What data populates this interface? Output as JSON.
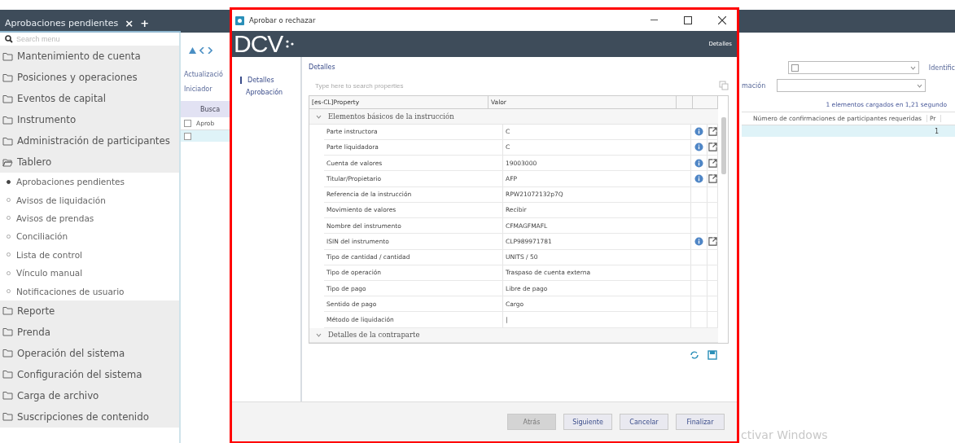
{
  "app": {
    "tab": {
      "label": "Aprobaciones pendientes",
      "close": "×",
      "add": "+"
    },
    "search_placeholder": "Search menu",
    "menu": [
      {
        "label": "Mantenimiento de cuenta",
        "expanded": false
      },
      {
        "label": "Posiciones y operaciones",
        "expanded": false
      },
      {
        "label": "Eventos de capital",
        "expanded": false
      },
      {
        "label": "Instrumento",
        "expanded": false
      },
      {
        "label": "Administración de participantes",
        "expanded": false
      },
      {
        "label": "Tablero",
        "expanded": true,
        "children": [
          {
            "label": "Aprobaciones pendientes",
            "selected": true
          },
          {
            "label": "Avisos de liquidación",
            "selected": false
          },
          {
            "label": "Avisos de prendas",
            "selected": false
          },
          {
            "label": "Conciliación",
            "selected": false
          },
          {
            "label": "Lista de control",
            "selected": false
          },
          {
            "label": "Vínculo manual",
            "selected": false
          },
          {
            "label": "Notificaciones de usuario",
            "selected": false
          }
        ]
      },
      {
        "label": "Reporte",
        "expanded": false
      },
      {
        "label": "Prenda",
        "expanded": false
      },
      {
        "label": "Operación del sistema",
        "expanded": false
      },
      {
        "label": "Configuración del sistema",
        "expanded": false
      },
      {
        "label": "Carga de archivo",
        "expanded": false
      },
      {
        "label": "Suscripciones de contenido",
        "expanded": false
      }
    ]
  },
  "background": {
    "left": {
      "labels": [
        "Actualizació",
        "Iniciador"
      ],
      "search_button": "Busca",
      "column": "Aprob",
      "select_all": {
        "checked": false
      }
    },
    "right": {
      "label_1": "Identific",
      "label_2": "mación",
      "status": "1 elementos cargados en 1,21 segundo",
      "column": "Número de confirmaciones de participantes requeridas",
      "column_2": "Pr",
      "rows": [
        {
          "value": "1",
          "selected": true,
          "checked": false
        }
      ]
    }
  },
  "dialog": {
    "title": "Aprobar o rechazar",
    "logo": "DCV",
    "header_link": "Detalles",
    "nav": [
      {
        "label": "Detalles",
        "selected": true
      },
      {
        "label": "Aprobación",
        "selected": false
      }
    ],
    "group_label": "Detalles",
    "search_placeholder": "Type here to search properties",
    "columns": [
      "[es-CL]Property",
      "Valor"
    ],
    "groups": [
      {
        "label": "Elementos básicos de la instrucción",
        "expanded": true,
        "rows": [
          {
            "property": "Parte instructora",
            "value": "C",
            "has_actions": true
          },
          {
            "property": "Parte liquidadora",
            "value": "C",
            "has_actions": true
          },
          {
            "property": "Cuenta de valores",
            "value": "19003000",
            "has_actions": true
          },
          {
            "property": "Titular/Propietario",
            "value": "AFP",
            "has_actions": true
          },
          {
            "property": "Referencia de la instrucción",
            "value": "RPW21072132p7Q",
            "has_actions": false
          },
          {
            "property": "Movimiento de valores",
            "value": "Recibir",
            "has_actions": false
          },
          {
            "property": "Nombre del instrumento",
            "value": "CFMAGFMAFL",
            "has_actions": false
          },
          {
            "property": "ISIN del instrumento",
            "value": "CLP989971781",
            "has_actions": true
          },
          {
            "property": "Tipo de cantidad / cantidad",
            "value": "UNITS / 50",
            "has_actions": false
          },
          {
            "property": "Tipo de operación",
            "value": "Traspaso de cuenta externa",
            "has_actions": false
          },
          {
            "property": "Tipo de pago",
            "value": "Libre de pago",
            "has_actions": false
          },
          {
            "property": "Sentido de pago",
            "value": "Cargo",
            "has_actions": false
          },
          {
            "property": "Método de liquidación",
            "value": "|",
            "has_actions": false
          }
        ]
      },
      {
        "label": "Detalles de la contraparte",
        "expanded": true
      }
    ],
    "buttons": [
      {
        "label": "Atrás",
        "disabled": true
      },
      {
        "label": "Siguiente",
        "disabled": false
      },
      {
        "label": "Cancelar",
        "disabled": false
      },
      {
        "label": "Finalizar",
        "disabled": false
      }
    ]
  },
  "os_notice": "ctivar Windows"
}
